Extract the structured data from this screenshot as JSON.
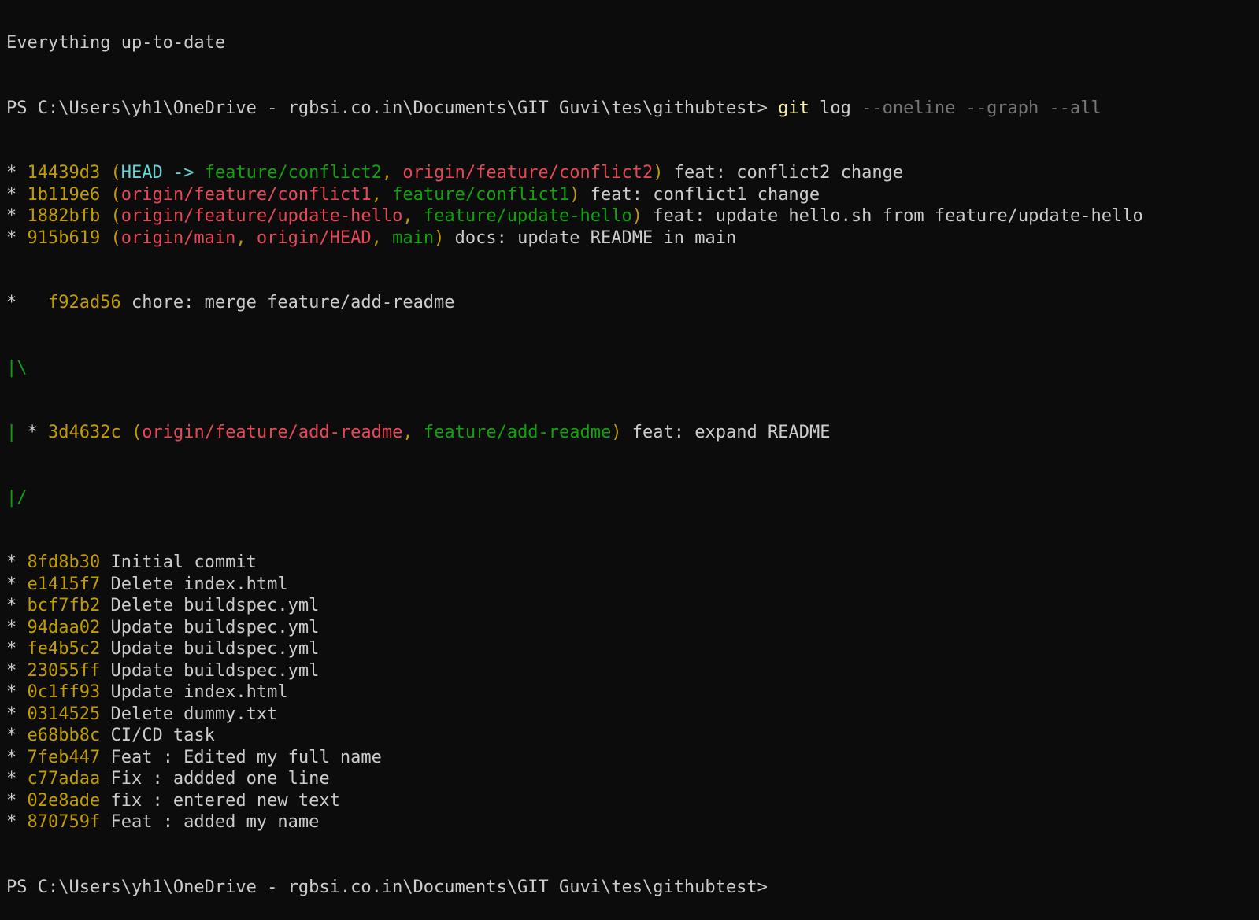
{
  "top_line": "Everything up-to-date",
  "prompt1": {
    "path": "PS C:\\Users\\yh1\\OneDrive - rgbsi.co.in\\Documents\\GIT Guvi\\tes\\githubtest> ",
    "cmd": "git",
    "args": " log ",
    "flags": "--oneline --graph --all"
  },
  "decorated": [
    {
      "graph": "* ",
      "hash": "14439d3",
      "refs": [
        {
          "text": "HEAD -> ",
          "kind": "head"
        },
        {
          "text": "feature/conflict2",
          "kind": "local"
        },
        {
          "text": "origin/feature/conflict2",
          "kind": "remote"
        }
      ],
      "msg": " feat: conflict2 change"
    },
    {
      "graph": "* ",
      "hash": "1b119e6",
      "refs": [
        {
          "text": "origin/feature/conflict1",
          "kind": "remote"
        },
        {
          "text": "feature/conflict1",
          "kind": "local"
        }
      ],
      "msg": " feat: conflict1 change"
    },
    {
      "graph": "* ",
      "hash": "1882bfb",
      "refs": [
        {
          "text": "origin/feature/update-hello",
          "kind": "remote"
        },
        {
          "text": "feature/update-hello",
          "kind": "local"
        }
      ],
      "msg": " feat: update hello.sh from feature/update-hello"
    },
    {
      "graph": "* ",
      "hash": "915b619",
      "refs": [
        {
          "text": "origin/main",
          "kind": "remote"
        },
        {
          "text": "origin/HEAD",
          "kind": "remote"
        },
        {
          "text": "main",
          "kind": "local"
        }
      ],
      "msg": " docs: update README in main"
    }
  ],
  "merge_line": {
    "graph": "*   ",
    "hash": "f92ad56",
    "msg": " chore: merge feature/add-readme"
  },
  "branch_open": "|\\",
  "side_commit": {
    "graph_bar": "|",
    "graph_star": " * ",
    "hash": "3d4632c",
    "refs": [
      {
        "text": "origin/feature/add-readme",
        "kind": "remote"
      },
      {
        "text": "feature/add-readme",
        "kind": "local"
      }
    ],
    "msg": " feat: expand README"
  },
  "branch_close": "|/",
  "commits": [
    {
      "hash": "8fd8b30",
      "msg": " Initial commit"
    },
    {
      "hash": "e1415f7",
      "msg": " Delete index.html"
    },
    {
      "hash": "bcf7fb2",
      "msg": " Delete buildspec.yml"
    },
    {
      "hash": "94daa02",
      "msg": " Update buildspec.yml"
    },
    {
      "hash": "fe4b5c2",
      "msg": " Update buildspec.yml"
    },
    {
      "hash": "23055ff",
      "msg": " Update buildspec.yml"
    },
    {
      "hash": "0c1ff93",
      "msg": " Update index.html"
    },
    {
      "hash": "0314525",
      "msg": " Delete dummy.txt"
    },
    {
      "hash": "e68bb8c",
      "msg": " CI/CD task"
    },
    {
      "hash": "7feb447",
      "msg": " Feat : Edited my full name"
    },
    {
      "hash": "c77adaa",
      "msg": " Fix : addded one line"
    },
    {
      "hash": "02e8ade",
      "msg": " fix : entered new text"
    },
    {
      "hash": "870759f",
      "msg": " Feat : added my name"
    }
  ],
  "prompt2": "PS C:\\Users\\yh1\\OneDrive - rgbsi.co.in\\Documents\\GIT Guvi\\tes\\githubtest>",
  "colors": {
    "background": "#0c0c0c",
    "text": "#cccccc",
    "hash": "#c19c00",
    "head": "#61d6d6",
    "local_branch": "#13a10e",
    "remote_branch": "#e74856",
    "command": "#f9f1a5",
    "flag": "#767676"
  }
}
